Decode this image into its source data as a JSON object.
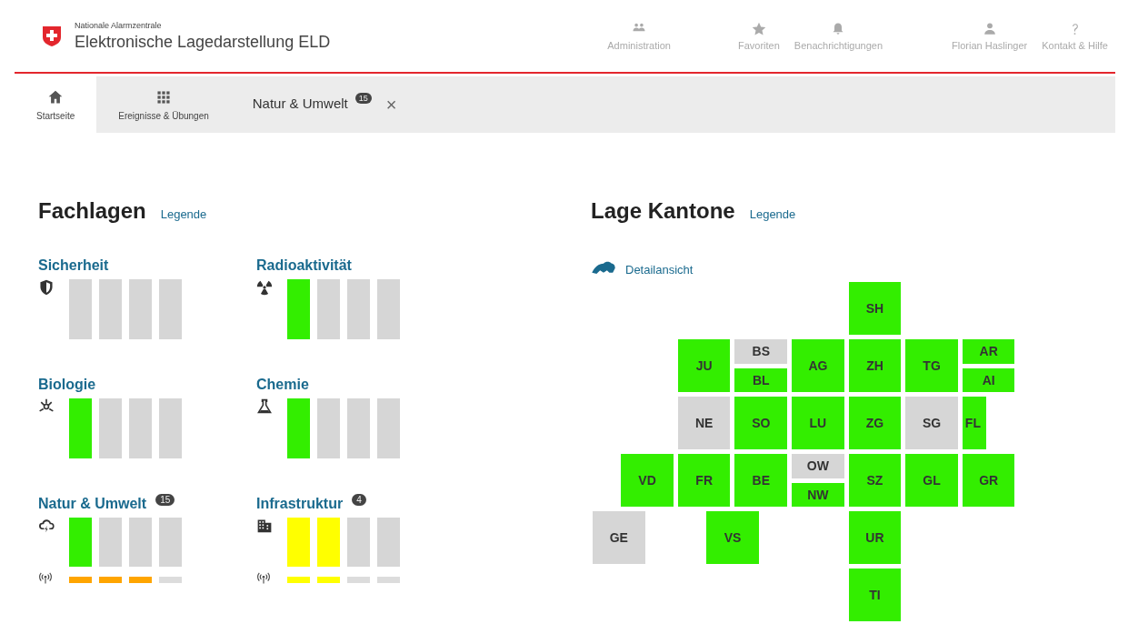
{
  "header": {
    "org": "Nationale Alarmzentrale",
    "title": "Elektronische Lagedarstellung ELD",
    "nav": [
      {
        "kind": "people",
        "label": "Administration"
      },
      {
        "kind": "star",
        "label": "Favoriten"
      },
      {
        "kind": "bell",
        "label": "Benachrichtigungen"
      },
      {
        "kind": "person",
        "label": "Florian Haslinger"
      },
      {
        "kind": "help",
        "label": "Kontakt & Hilfe"
      }
    ]
  },
  "tabs": [
    {
      "kind": "home",
      "label": "Startseite",
      "selected": true
    },
    {
      "kind": "grid",
      "label": "Ereignisse & Übungen",
      "selected": false
    },
    {
      "kind": "closable",
      "label": "Natur & Umwelt",
      "badge": "15",
      "close": "×",
      "selected": false
    }
  ],
  "fachlagen": {
    "title": "Fachlagen",
    "legend": "Legende",
    "items": [
      {
        "title": "Sicherheit",
        "kind": "shield",
        "bars": [
          {
            "color": "#d6d6d6"
          },
          {
            "color": "#d6d6d6"
          },
          {
            "color": "#d6d6d6"
          },
          {
            "color": "#d6d6d6"
          }
        ]
      },
      {
        "title": "Radioaktivität",
        "kind": "radiation",
        "bars": [
          {
            "color": "#33ee00"
          },
          {
            "color": "#d6d6d6"
          },
          {
            "color": "#d6d6d6"
          },
          {
            "color": "#d6d6d6"
          }
        ]
      },
      {
        "title": "Biologie",
        "kind": "biohazard",
        "bars": [
          {
            "color": "#33ee00"
          },
          {
            "color": "#d6d6d6"
          },
          {
            "color": "#d6d6d6"
          },
          {
            "color": "#d6d6d6"
          }
        ]
      },
      {
        "title": "Chemie",
        "kind": "flask",
        "bars": [
          {
            "color": "#33ee00"
          },
          {
            "color": "#d6d6d6"
          },
          {
            "color": "#d6d6d6"
          },
          {
            "color": "#d6d6d6"
          }
        ]
      },
      {
        "title": "Natur & Umwelt",
        "badge": "15",
        "kind": "cloud",
        "bars": [
          {
            "color": "#33ee00"
          },
          {
            "color": "#d6d6d6"
          },
          {
            "color": "#d6d6d6"
          },
          {
            "color": "#d6d6d6"
          }
        ],
        "signal_bars": [
          {
            "color": "#ffa500"
          },
          {
            "color": "#ffa500"
          },
          {
            "color": "#ffa500"
          },
          {
            "color": "#dcdcdc"
          }
        ]
      },
      {
        "title": "Infrastruktur",
        "badge": "4",
        "kind": "building",
        "bars": [
          {
            "color": "#ffff00"
          },
          {
            "color": "#ffff00"
          },
          {
            "color": "#d6d6d6"
          },
          {
            "color": "#d6d6d6"
          }
        ],
        "signal_bars": [
          {
            "color": "#ffff00"
          },
          {
            "color": "#ffff00"
          },
          {
            "color": "#dcdcdc"
          },
          {
            "color": "#dcdcdc"
          }
        ]
      }
    ]
  },
  "kantone": {
    "title": "Lage Kantone",
    "legend": "Legende",
    "detail": "Detailansicht",
    "cantons": [
      {
        "code": "SH",
        "color": "#33ee00"
      },
      {
        "code": "JU",
        "color": "#33ee00"
      },
      {
        "code": "BS",
        "color": "#d6d6d6"
      },
      {
        "code": "BL",
        "color": "#33ee00"
      },
      {
        "code": "AG",
        "color": "#33ee00"
      },
      {
        "code": "ZH",
        "color": "#33ee00"
      },
      {
        "code": "TG",
        "color": "#33ee00"
      },
      {
        "code": "AR",
        "color": "#33ee00"
      },
      {
        "code": "AI",
        "color": "#33ee00"
      },
      {
        "code": "NE",
        "color": "#d6d6d6"
      },
      {
        "code": "SO",
        "color": "#33ee00"
      },
      {
        "code": "LU",
        "color": "#33ee00"
      },
      {
        "code": "ZG",
        "color": "#33ee00"
      },
      {
        "code": "SG",
        "color": "#d6d6d6"
      },
      {
        "code": "FL",
        "color": "#33ee00"
      },
      {
        "code": "VD",
        "color": "#33ee00"
      },
      {
        "code": "FR",
        "color": "#33ee00"
      },
      {
        "code": "BE",
        "color": "#33ee00"
      },
      {
        "code": "OW",
        "color": "#d6d6d6"
      },
      {
        "code": "NW",
        "color": "#33ee00"
      },
      {
        "code": "SZ",
        "color": "#33ee00"
      },
      {
        "code": "GL",
        "color": "#33ee00"
      },
      {
        "code": "GR",
        "color": "#33ee00"
      },
      {
        "code": "GE",
        "color": "#d6d6d6"
      },
      {
        "code": "VS",
        "color": "#33ee00"
      },
      {
        "code": "UR",
        "color": "#33ee00"
      },
      {
        "code": "TI",
        "color": "#33ee00"
      }
    ]
  }
}
